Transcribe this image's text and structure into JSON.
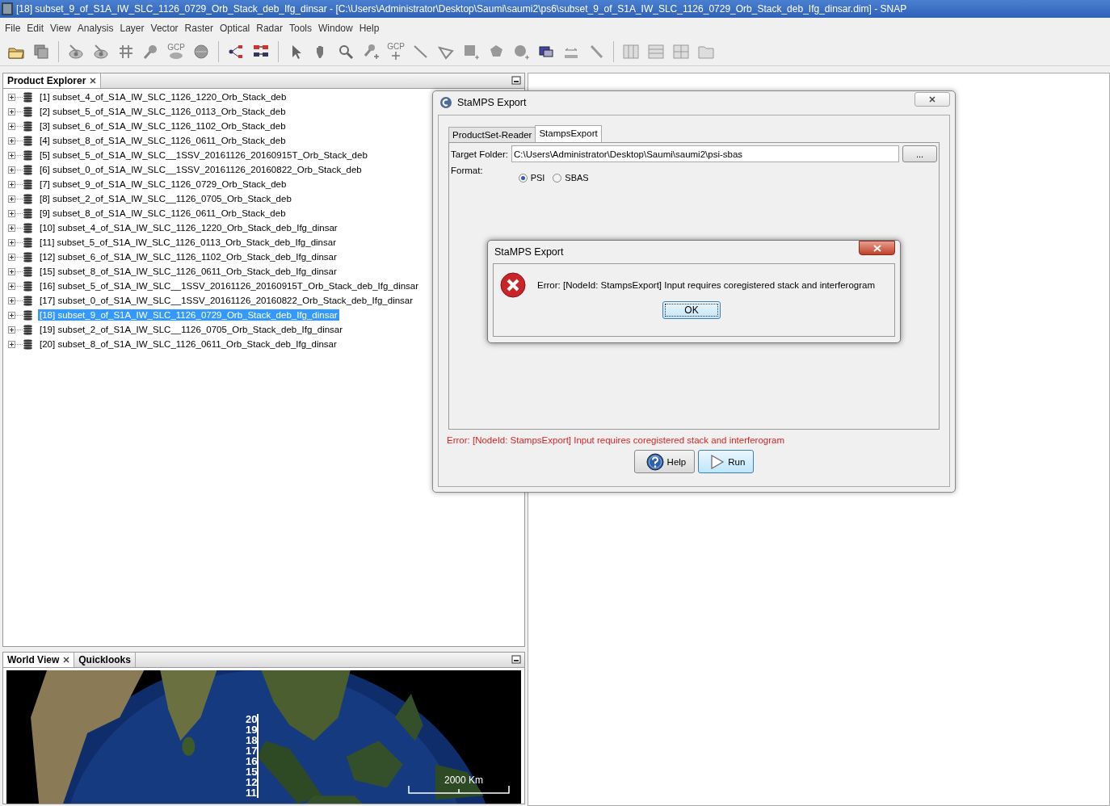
{
  "window": {
    "title": "[18] subset_9_of_S1A_IW_SLC_1126_0729_Orb_Stack_deb_Ifg_dinsar - [C:\\Users\\Administrator\\Desktop\\Saumi\\saumi2\\ps6\\subset_9_of_S1A_IW_SLC_1126_0729_Orb_Stack_deb_Ifg_dinsar.dim] - SNAP"
  },
  "menu": [
    "File",
    "Edit",
    "View",
    "Analysis",
    "Layer",
    "Vector",
    "Raster",
    "Optical",
    "Radar",
    "Tools",
    "Window",
    "Help"
  ],
  "toolbar": {
    "gcp_labels": [
      "GCP",
      "GCP"
    ]
  },
  "product_explorer": {
    "title": "Product Explorer",
    "products": [
      {
        "label": "[1] subset_4_of_S1A_IW_SLC_1126_1220_Orb_Stack_deb",
        "selected": false
      },
      {
        "label": "[2] subset_5_of_S1A_IW_SLC_1126_0113_Orb_Stack_deb",
        "selected": false
      },
      {
        "label": "[3] subset_6_of_S1A_IW_SLC_1126_1102_Orb_Stack_deb",
        "selected": false
      },
      {
        "label": "[4] subset_8_of_S1A_IW_SLC_1126_0611_Orb_Stack_deb",
        "selected": false
      },
      {
        "label": "[5] subset_5_of_S1A_IW_SLC__1SSV_20161126_20160915T_Orb_Stack_deb",
        "selected": false
      },
      {
        "label": "[6] subset_0_of_S1A_IW_SLC__1SSV_20161126_20160822_Orb_Stack_deb",
        "selected": false
      },
      {
        "label": "[7] subset_9_of_S1A_IW_SLC_1126_0729_Orb_Stack_deb",
        "selected": false
      },
      {
        "label": "[8] subset_2_of_S1A_IW_SLC__1126_0705_Orb_Stack_deb",
        "selected": false
      },
      {
        "label": "[9] subset_8_of_S1A_IW_SLC_1126_0611_Orb_Stack_deb",
        "selected": false
      },
      {
        "label": "[10] subset_4_of_S1A_IW_SLC_1126_1220_Orb_Stack_deb_Ifg_dinsar",
        "selected": false
      },
      {
        "label": "[11] subset_5_of_S1A_IW_SLC_1126_0113_Orb_Stack_deb_Ifg_dinsar",
        "selected": false
      },
      {
        "label": "[12] subset_6_of_S1A_IW_SLC_1126_1102_Orb_Stack_deb_Ifg_dinsar",
        "selected": false
      },
      {
        "label": "[15] subset_8_of_S1A_IW_SLC_1126_0611_Orb_Stack_deb_Ifg_dinsar",
        "selected": false
      },
      {
        "label": "[16] subset_5_of_S1A_IW_SLC__1SSV_20161126_20160915T_Orb_Stack_deb_Ifg_dinsar",
        "selected": false
      },
      {
        "label": "[17] subset_0_of_S1A_IW_SLC__1SSV_20161126_20160822_Orb_Stack_deb_Ifg_dinsar",
        "selected": false
      },
      {
        "label": "[18] subset_9_of_S1A_IW_SLC_1126_0729_Orb_Stack_deb_Ifg_dinsar",
        "selected": true
      },
      {
        "label": "[19] subset_2_of_S1A_IW_SLC__1126_0705_Orb_Stack_deb_Ifg_dinsar",
        "selected": false
      },
      {
        "label": "[20] subset_8_of_S1A_IW_SLC_1126_0611_Orb_Stack_deb_Ifg_dinsar",
        "selected": false
      }
    ]
  },
  "world_view": {
    "tabs": [
      {
        "label": "World View",
        "selected": true
      },
      {
        "label": "Quicklooks",
        "selected": false
      }
    ],
    "product_labels": [
      "20",
      "19",
      "18",
      "17",
      "16",
      "15",
      "12",
      "11"
    ],
    "scale_label": "2000 Km"
  },
  "stamps_dialog": {
    "title": "StaMPS Export",
    "tabs": [
      {
        "label": "ProductSet-Reader",
        "selected": false
      },
      {
        "label": "StampsExport",
        "selected": true
      }
    ],
    "target_folder_label": "Target Folder:",
    "target_folder": "C:\\Users\\Administrator\\Desktop\\Saumi\\saumi2\\psi-sbas",
    "browse_button": "...",
    "format_label": "Format:",
    "formats": [
      {
        "label": "PSI",
        "selected": true
      },
      {
        "label": "SBAS",
        "selected": false
      }
    ],
    "error": "Error: [NodeId: StampsExport] Input requires coregistered stack and interferogram",
    "buttons": [
      {
        "kind": "help",
        "label": "Help"
      },
      {
        "kind": "run",
        "label": "Run"
      }
    ]
  },
  "error_dialog": {
    "title": "StaMPS Export",
    "message": "Error: [NodeId: StampsExport] Input requires coregistered stack and interferogram",
    "ok": "OK"
  }
}
